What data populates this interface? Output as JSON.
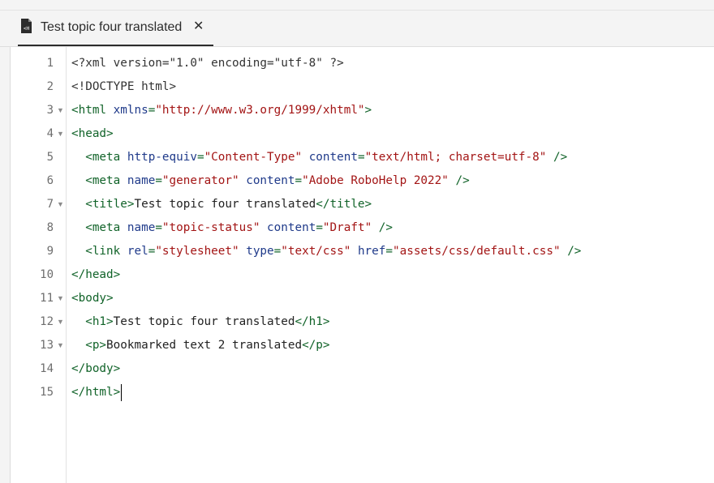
{
  "tab": {
    "title": "Test topic four translated",
    "close_label": "✕",
    "icon": "html-file-icon"
  },
  "colors": {
    "tag": "#116329",
    "attr": "#1f3a8a",
    "string": "#a31515",
    "text": "#222222"
  },
  "editor": {
    "lines": [
      {
        "num": "1",
        "fold": "",
        "indent": "",
        "tokens": [
          {
            "t": "pi",
            "v": "<?xml version=\"1.0\" encoding=\"utf-8\" ?>"
          }
        ]
      },
      {
        "num": "2",
        "fold": "",
        "indent": "",
        "tokens": [
          {
            "t": "pi",
            "v": "<!DOCTYPE html>"
          }
        ]
      },
      {
        "num": "3",
        "fold": "▼",
        "indent": "",
        "tokens": [
          {
            "t": "tag",
            "v": "<html "
          },
          {
            "t": "attr",
            "v": "xmlns"
          },
          {
            "t": "tag",
            "v": "="
          },
          {
            "t": "str",
            "v": "\"http://www.w3.org/1999/xhtml\""
          },
          {
            "t": "tag",
            "v": ">"
          }
        ]
      },
      {
        "num": "4",
        "fold": "▼",
        "indent": "",
        "tokens": [
          {
            "t": "tag",
            "v": "<head>"
          }
        ]
      },
      {
        "num": "5",
        "fold": "",
        "indent": "  ",
        "tokens": [
          {
            "t": "tag",
            "v": "<meta "
          },
          {
            "t": "attr",
            "v": "http-equiv"
          },
          {
            "t": "tag",
            "v": "="
          },
          {
            "t": "str",
            "v": "\"Content-Type\""
          },
          {
            "t": "text",
            "v": " "
          },
          {
            "t": "attr",
            "v": "content"
          },
          {
            "t": "tag",
            "v": "="
          },
          {
            "t": "str",
            "v": "\"text/html; charset=utf-8\""
          },
          {
            "t": "tag",
            "v": " />"
          }
        ]
      },
      {
        "num": "6",
        "fold": "",
        "indent": "  ",
        "tokens": [
          {
            "t": "tag",
            "v": "<meta "
          },
          {
            "t": "attr",
            "v": "name"
          },
          {
            "t": "tag",
            "v": "="
          },
          {
            "t": "str",
            "v": "\"generator\""
          },
          {
            "t": "text",
            "v": " "
          },
          {
            "t": "attr",
            "v": "content"
          },
          {
            "t": "tag",
            "v": "="
          },
          {
            "t": "str",
            "v": "\"Adobe RoboHelp 2022\""
          },
          {
            "t": "tag",
            "v": " />"
          }
        ]
      },
      {
        "num": "7",
        "fold": "▼",
        "indent": "  ",
        "tokens": [
          {
            "t": "tag",
            "v": "<title>"
          },
          {
            "t": "text",
            "v": "Test topic four translated"
          },
          {
            "t": "tag",
            "v": "</title>"
          }
        ]
      },
      {
        "num": "8",
        "fold": "",
        "indent": "  ",
        "tokens": [
          {
            "t": "tag",
            "v": "<meta "
          },
          {
            "t": "attr",
            "v": "name"
          },
          {
            "t": "tag",
            "v": "="
          },
          {
            "t": "str",
            "v": "\"topic-status\""
          },
          {
            "t": "text",
            "v": " "
          },
          {
            "t": "attr",
            "v": "content"
          },
          {
            "t": "tag",
            "v": "="
          },
          {
            "t": "str",
            "v": "\"Draft\""
          },
          {
            "t": "tag",
            "v": " />"
          }
        ]
      },
      {
        "num": "9",
        "fold": "",
        "indent": "  ",
        "tokens": [
          {
            "t": "tag",
            "v": "<link "
          },
          {
            "t": "attr",
            "v": "rel"
          },
          {
            "t": "tag",
            "v": "="
          },
          {
            "t": "str",
            "v": "\"stylesheet\""
          },
          {
            "t": "text",
            "v": " "
          },
          {
            "t": "attr",
            "v": "type"
          },
          {
            "t": "tag",
            "v": "="
          },
          {
            "t": "str",
            "v": "\"text/css\""
          },
          {
            "t": "text",
            "v": " "
          },
          {
            "t": "attr",
            "v": "href"
          },
          {
            "t": "tag",
            "v": "="
          },
          {
            "t": "str",
            "v": "\"assets/css/default.css\""
          },
          {
            "t": "tag",
            "v": " />"
          }
        ]
      },
      {
        "num": "10",
        "fold": "",
        "indent": "",
        "tokens": [
          {
            "t": "tag",
            "v": "</head>"
          }
        ]
      },
      {
        "num": "11",
        "fold": "▼",
        "indent": "",
        "tokens": [
          {
            "t": "tag",
            "v": "<body>"
          }
        ]
      },
      {
        "num": "12",
        "fold": "▼",
        "indent": "  ",
        "tokens": [
          {
            "t": "tag",
            "v": "<h1>"
          },
          {
            "t": "text",
            "v": "Test topic four translated"
          },
          {
            "t": "tag",
            "v": "</h1>"
          }
        ]
      },
      {
        "num": "13",
        "fold": "▼",
        "indent": "  ",
        "tokens": [
          {
            "t": "tag",
            "v": "<p>"
          },
          {
            "t": "text",
            "v": "Bookmarked text 2 translated"
          },
          {
            "t": "tag",
            "v": "</p>"
          }
        ]
      },
      {
        "num": "14",
        "fold": "",
        "indent": "",
        "tokens": [
          {
            "t": "tag",
            "v": "</body>"
          }
        ]
      },
      {
        "num": "15",
        "fold": "",
        "indent": "",
        "caret": true,
        "tokens": [
          {
            "t": "tag",
            "v": "</html>"
          }
        ]
      }
    ]
  }
}
